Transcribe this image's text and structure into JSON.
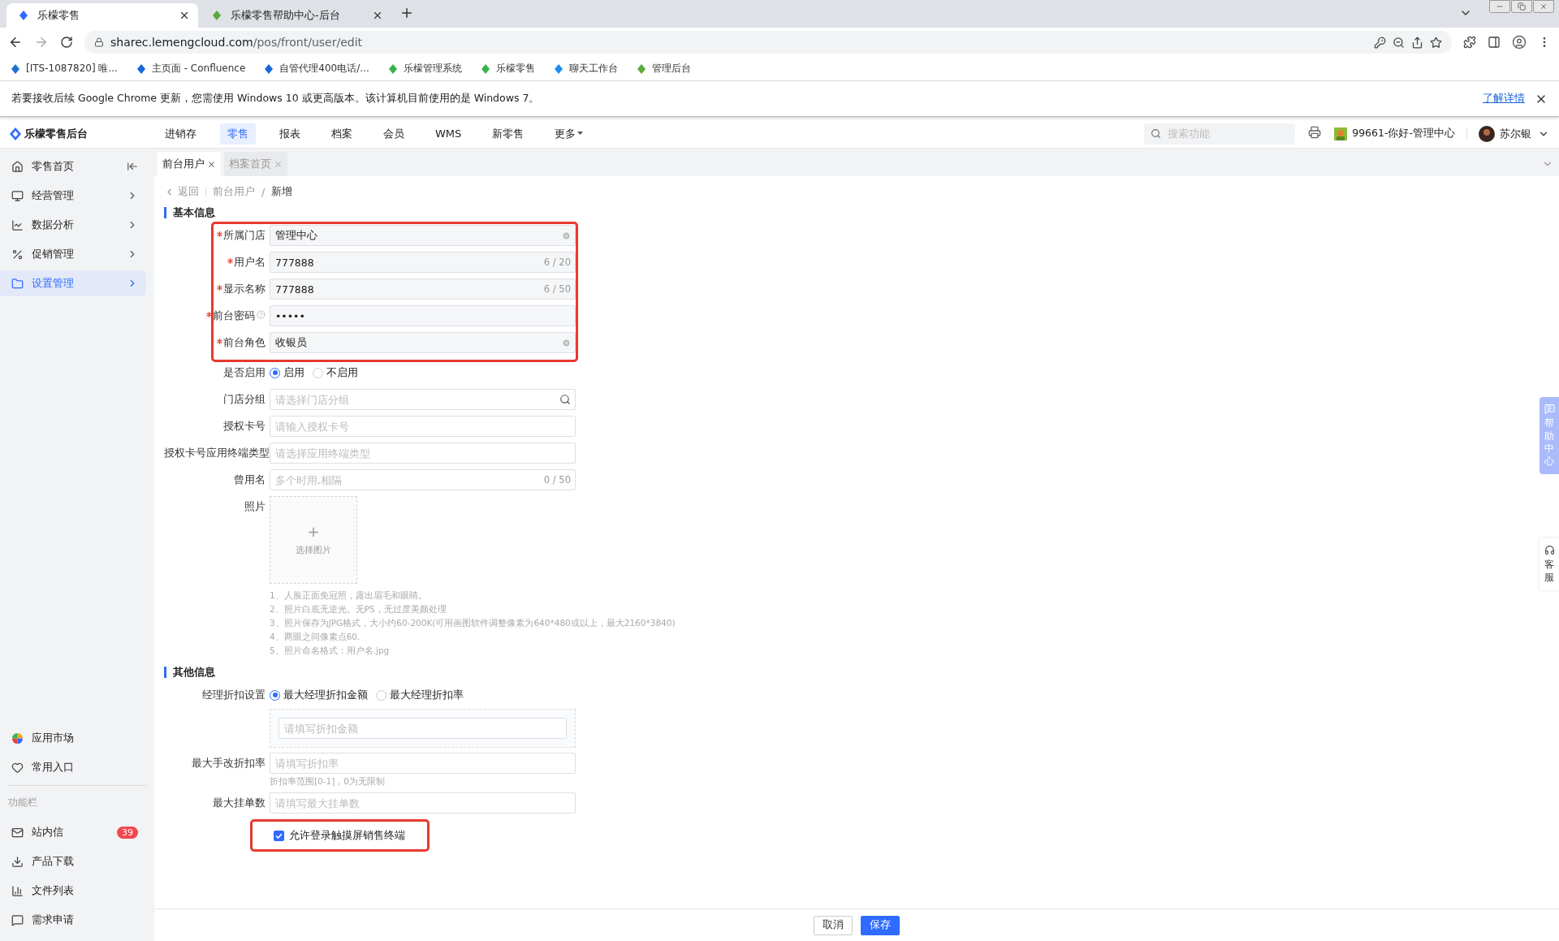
{
  "browser": {
    "tabs": [
      {
        "title": "乐檬零售",
        "selected": true
      },
      {
        "title": "乐檬零售帮助中心-后台",
        "selected": false
      }
    ],
    "url_host": "sharec.lemengcloud.com",
    "url_path": "/pos/front/user/edit",
    "bookmarks": [
      "[ITS-1087820] 唯...",
      "主页面 - Confluence",
      "自管代理400电话/...",
      "乐檬管理系统",
      "乐檬零售",
      "聊天工作台",
      "管理后台"
    ]
  },
  "infobar": {
    "message": "若要接收后续 Google Chrome 更新，您需使用 Windows 10 或更高版本。该计算机目前使用的是 Windows 7。",
    "link": "了解详情"
  },
  "app_header": {
    "brand": "乐檬零售后台",
    "nav": [
      {
        "label": "进销存",
        "selected": false,
        "dropdown": false
      },
      {
        "label": "零售",
        "selected": true,
        "dropdown": false
      },
      {
        "label": "报表",
        "selected": false,
        "dropdown": false
      },
      {
        "label": "档案",
        "selected": false,
        "dropdown": false
      },
      {
        "label": "会员",
        "selected": false,
        "dropdown": false
      },
      {
        "label": "WMS",
        "selected": false,
        "dropdown": false
      },
      {
        "label": "新零售",
        "selected": false,
        "dropdown": false
      },
      {
        "label": "更多",
        "selected": false,
        "dropdown": true
      }
    ],
    "search": {
      "placeholder": "搜索功能"
    },
    "store": "99661-你好-管理中心",
    "user": "苏尔银"
  },
  "sidebar": {
    "items": [
      {
        "label": "零售首页",
        "selected": false,
        "kind": "collapse"
      },
      {
        "label": "经营管理",
        "selected": false,
        "kind": "menu"
      },
      {
        "label": "数据分析",
        "selected": false,
        "kind": "menu"
      },
      {
        "label": "促销管理",
        "selected": false,
        "kind": "menu"
      },
      {
        "label": "设置管理",
        "selected": true,
        "kind": "menu"
      }
    ],
    "shortcuts": [
      "应用市场",
      "常用入口"
    ],
    "section_label": "功能栏",
    "tools": [
      {
        "label": "站内信",
        "badge": "39"
      },
      {
        "label": "产品下载"
      },
      {
        "label": "文件列表"
      },
      {
        "label": "需求申请"
      }
    ]
  },
  "page_tabs": [
    {
      "label": "前台用户",
      "selected": true
    },
    {
      "label": "档案首页",
      "selected": false
    }
  ],
  "breadcrumb": {
    "back": "返回",
    "separator": "/",
    "items": [
      "前台用户",
      "新增"
    ]
  },
  "sections": [
    {
      "title": "基本信息",
      "groups": [
        {
          "highlighted": true,
          "fields": [
            {
              "kind": "select",
              "label": "所属门店",
              "required": true,
              "value": "管理中心",
              "clearable": true
            },
            {
              "kind": "text",
              "label": "用户名",
              "required": true,
              "value": "777888",
              "counter": "6 / 20"
            },
            {
              "kind": "text",
              "label": "显示名称",
              "required": true,
              "value": "777888",
              "counter": "6 / 50"
            },
            {
              "kind": "text",
              "label": "前台密码",
              "required": true,
              "value": "•••••",
              "help": true
            },
            {
              "kind": "select",
              "label": "前台角色",
              "required": true,
              "value": "收银员",
              "clearable": true
            }
          ]
        },
        {
          "highlighted": false,
          "fields": [
            {
              "kind": "radio",
              "label": "是否启用",
              "options": [
                {
                  "label": "启用",
                  "selected": true
                },
                {
                  "label": "不启用",
                  "selected": false
                }
              ]
            },
            {
              "kind": "search",
              "label": "门店分组",
              "placeholder": "请选择门店分组"
            },
            {
              "kind": "text",
              "label": "授权卡号",
              "placeholder": "请输入授权卡号"
            },
            {
              "kind": "select",
              "label": "授权卡号应用终端类型",
              "placeholder": "请选择应用终端类型"
            },
            {
              "kind": "text",
              "label": "曾用名",
              "placeholder": "多个时用,相隔",
              "counter": "0 / 50"
            },
            {
              "label": "照片",
              "plus": "+",
              "button": "选择图片",
              "notes": [
                "1、人脸正面免冠照，露出眉毛和眼睛。",
                "2、照片白底无逆光。无PS，无过度美颜处理",
                "3、照片保存为JPG格式，大小约60-200K(可用画图软件调整像素为640*480或以上，最大2160*3840)",
                "4、两眼之间像素点60.",
                "5、照片命名格式：用户名.jpg"
              ]
            }
          ]
        }
      ]
    },
    {
      "title": "其他信息",
      "groups": [
        {
          "highlighted": false,
          "fields": [
            {
              "kind": "radio",
              "label": "经理折扣设置",
              "options": [
                {
                  "label": "最大经理折扣金额",
                  "selected": true
                },
                {
                  "label": "最大经理折扣率",
                  "selected": false
                }
              ],
              "sub_placeholder": "请填写折扣金额"
            },
            {
              "kind": "text",
              "label": "最大手改折扣率",
              "placeholder": "请填写折扣率",
              "hint": "折扣率范围[0-1]，0为无限制"
            },
            {
              "kind": "text",
              "label": "最大挂单数",
              "placeholder": "请填写最大挂单数"
            }
          ]
        },
        {
          "highlighted": true,
          "fields": [
            {
              "kind": "checkbox",
              "label": "允许登录触摸屏销售终端",
              "checked": true
            }
          ]
        }
      ]
    }
  ],
  "footer": [
    {
      "label": "取消",
      "kind": "default"
    },
    {
      "label": "保存",
      "kind": "primary"
    }
  ],
  "float_tabs": [
    {
      "label": "帮助中心",
      "kind": "help"
    },
    {
      "label": "客服",
      "kind": "service"
    }
  ]
}
